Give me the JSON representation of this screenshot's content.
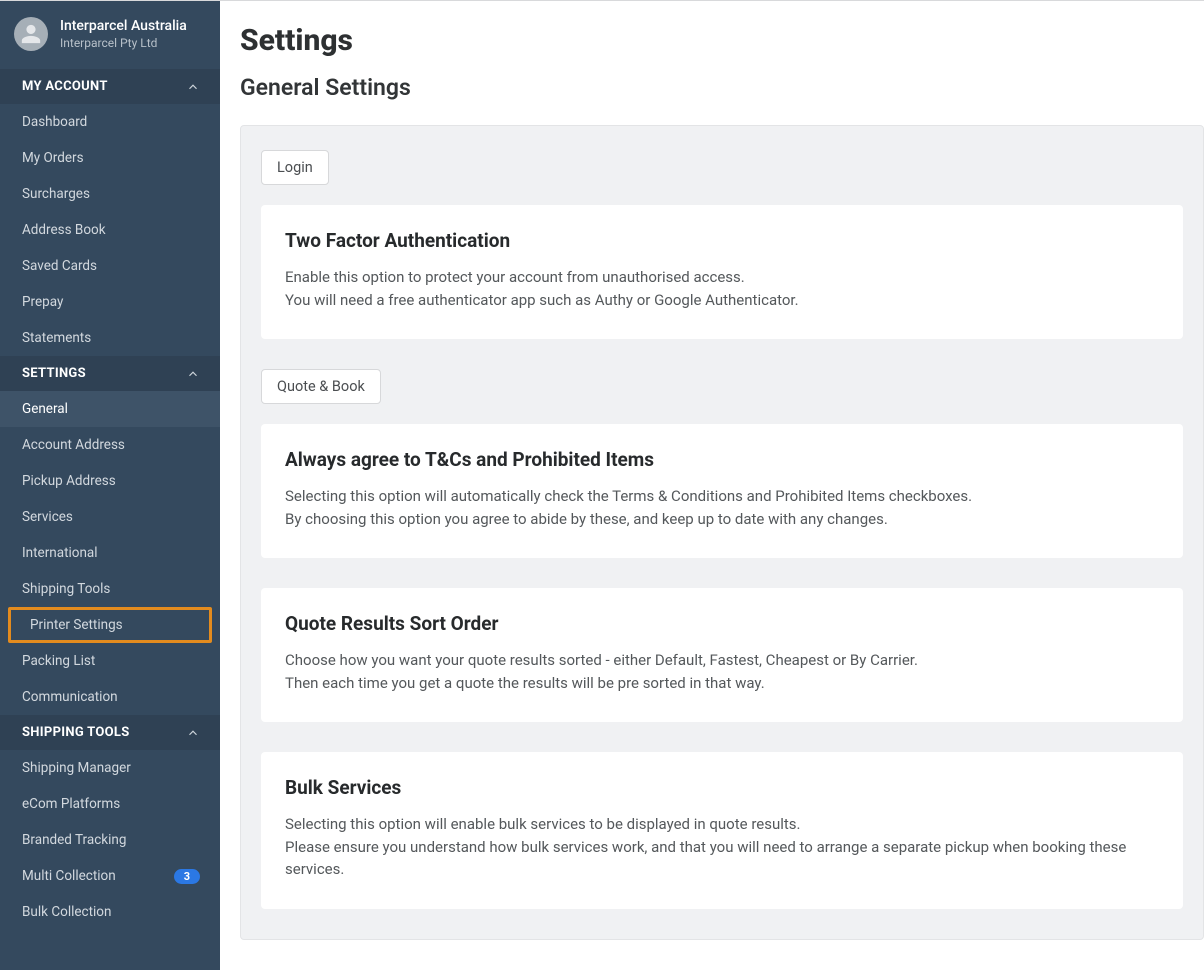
{
  "profile": {
    "name": "Interparcel Australia",
    "org": "Interparcel Pty Ltd"
  },
  "sidebar": {
    "sections": [
      {
        "label": "MY ACCOUNT",
        "items": [
          {
            "label": "Dashboard"
          },
          {
            "label": "My Orders"
          },
          {
            "label": "Surcharges"
          },
          {
            "label": "Address Book"
          },
          {
            "label": "Saved Cards"
          },
          {
            "label": "Prepay"
          },
          {
            "label": "Statements"
          }
        ]
      },
      {
        "label": "SETTINGS",
        "items": [
          {
            "label": "General"
          },
          {
            "label": "Account Address"
          },
          {
            "label": "Pickup Address"
          },
          {
            "label": "Services"
          },
          {
            "label": "International"
          },
          {
            "label": "Shipping Tools"
          },
          {
            "label": "Printer Settings"
          },
          {
            "label": "Packing List"
          },
          {
            "label": "Communication"
          }
        ]
      },
      {
        "label": "SHIPPING TOOLS",
        "items": [
          {
            "label": "Shipping Manager"
          },
          {
            "label": "eCom Platforms"
          },
          {
            "label": "Branded Tracking"
          },
          {
            "label": "Multi Collection",
            "badge": "3"
          },
          {
            "label": "Bulk Collection"
          }
        ]
      }
    ]
  },
  "main": {
    "title": "Settings",
    "subtitle": "General Settings",
    "pill_login": "Login",
    "pill_quote": "Quote & Book",
    "cards": [
      {
        "title": "Two Factor Authentication",
        "line1": "Enable this option to protect your account from unauthorised access.",
        "line2": "You will need a free authenticator app such as Authy or Google Authenticator."
      },
      {
        "title": "Always agree to T&Cs and Prohibited Items",
        "line1": "Selecting this option will automatically check the Terms & Conditions and Prohibited Items checkboxes.",
        "line2": "By choosing this option you agree to abide by these, and keep up to date with any changes."
      },
      {
        "title": "Quote Results Sort Order",
        "line1": "Choose how you want your quote results sorted - either Default, Fastest, Cheapest or By Carrier.",
        "line2": "Then each time you get a quote the results will be pre sorted in that way."
      },
      {
        "title": "Bulk Services",
        "line1": "Selecting this option will enable bulk services to be displayed in quote results.",
        "line2": "Please ensure you understand how bulk services work, and that you will need to arrange a separate pickup when booking these services."
      }
    ]
  }
}
